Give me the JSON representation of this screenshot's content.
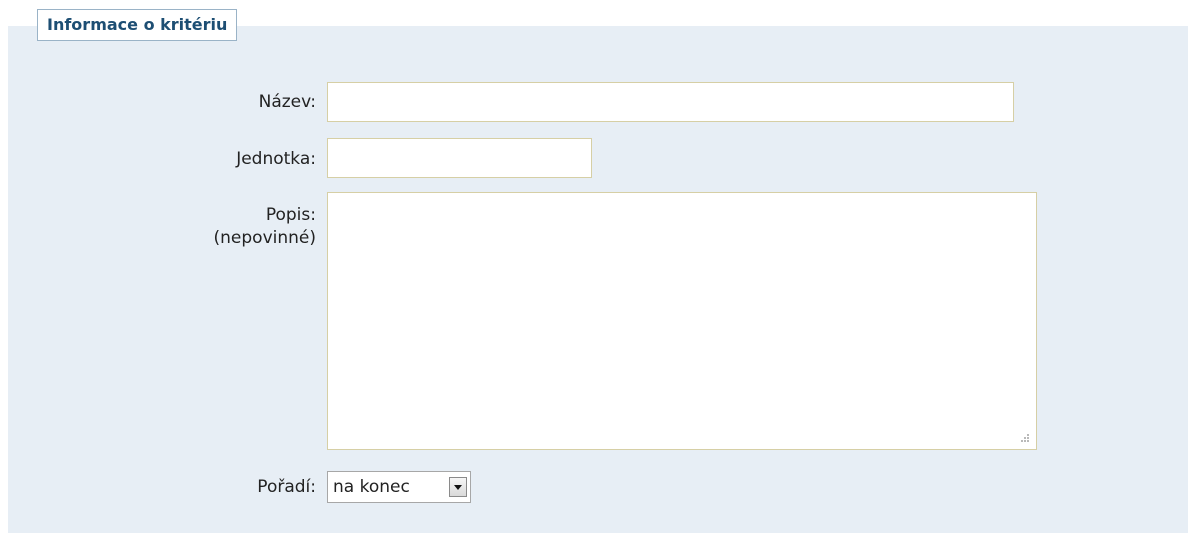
{
  "form": {
    "legend": "Informace o kritériu",
    "name": {
      "label": "Název:",
      "value": ""
    },
    "unit": {
      "label": "Jednotka:",
      "value": ""
    },
    "description": {
      "label_line1": "Popis:",
      "label_line2": "(nepovinné)",
      "value": ""
    },
    "order": {
      "label": "Pořadí:",
      "selected": "na konec",
      "icon": "chevron-down-icon"
    }
  },
  "colors": {
    "panel_background": "#e7eef5",
    "legend_text": "#1d4e73",
    "legend_border": "#9ab3c7",
    "input_border": "#d6cfa5"
  }
}
